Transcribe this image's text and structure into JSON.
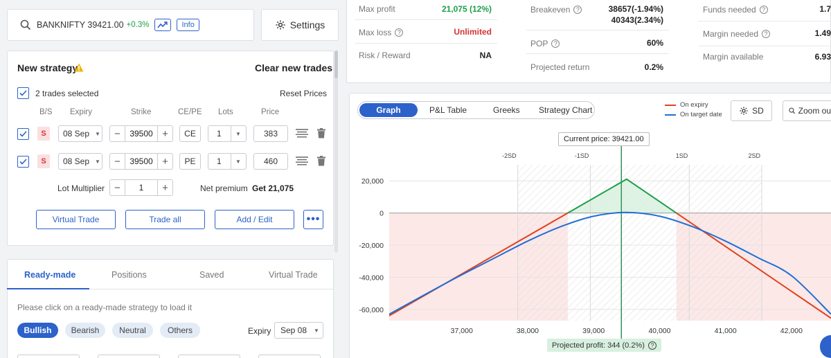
{
  "search": {
    "symbol_price": "BANKNIFTY 39421.00",
    "change": "+0.3%",
    "info_label": "Info"
  },
  "settings": {
    "label": "Settings"
  },
  "strategy": {
    "title": "New strategy",
    "clear_label": "Clear new trades",
    "trades_selected": "2 trades selected",
    "reset_label": "Reset Prices",
    "columns": [
      "B/S",
      "Expiry",
      "Strike",
      "CE/PE",
      "Lots",
      "Price"
    ],
    "trades": [
      {
        "side": "S",
        "expiry": "08 Sep",
        "strike": "39500",
        "type": "CE",
        "lots": "1",
        "price": "383"
      },
      {
        "side": "S",
        "expiry": "08 Sep",
        "strike": "39500",
        "type": "PE",
        "lots": "1",
        "price": "460"
      }
    ],
    "lot_multiplier_label": "Lot Multiplier",
    "lot_multiplier_value": "1",
    "net_premium_label": "Net premium",
    "net_premium_value": "Get 21,075",
    "buttons": {
      "virtual_trade": "Virtual Trade",
      "trade_all": "Trade all",
      "add_edit": "Add / Edit"
    }
  },
  "tabs_panel": {
    "tabs": [
      "Ready-made",
      "Positions",
      "Saved",
      "Virtual Trade"
    ],
    "hint": "Please click on a ready-made strategy to load it",
    "filters": [
      "Bullish",
      "Bearish",
      "Neutral",
      "Others"
    ],
    "expiry_label": "Expiry",
    "expiry_value": "Sep 08"
  },
  "stats": {
    "max_profit_label": "Max profit",
    "max_profit_value": "21,075 (12%)",
    "max_loss_label": "Max loss",
    "max_loss_value": "Unlimited",
    "risk_reward_label": "Risk / Reward",
    "risk_reward_value": "NA",
    "breakeven_label": "Breakeven",
    "breakeven_value_1": "38657(-1.94%)",
    "breakeven_value_2": "40343(2.34%)",
    "pop_label": "POP",
    "pop_value": "60%",
    "projected_return_label": "Projected return",
    "projected_return_value": "0.2%",
    "funds_needed_label": "Funds needed",
    "funds_needed_value": "1.7",
    "margin_needed_label": "Margin needed",
    "margin_needed_value": "1.49",
    "margin_available_label": "Margin available",
    "margin_available_value": "6.93"
  },
  "graph_tabs": {
    "items": [
      "Graph",
      "P&L Table",
      "Greeks",
      "Strategy Chart"
    ],
    "active": "Graph"
  },
  "legend": {
    "on_expiry": "On expiry",
    "on_target": "On target date"
  },
  "sd_button": "SD",
  "zoom_button": "Zoom ou",
  "colors": {
    "accent": "#2c62c9",
    "profit": "#1e9e4a",
    "loss": "#d33333",
    "expiry_line": "#e0431f",
    "target_line": "#1f6fd6"
  },
  "chart_data": {
    "type": "line",
    "x_ticks": [
      "37,000",
      "38,000",
      "39,000",
      "40,000",
      "41,000",
      "42,000"
    ],
    "y_ticks": [
      "20,000",
      "0",
      "-20,000",
      "-40,000",
      "-60,000"
    ],
    "xlim": [
      35900,
      42600
    ],
    "ylim": [
      -67000,
      30000
    ],
    "sd_labels": [
      "-2SD",
      "-1SD",
      "1SD",
      "2SD"
    ],
    "sd_values": [
      37850,
      38950,
      40450,
      41550
    ],
    "current_price": 39421,
    "current_price_label": "Current price: 39421.00",
    "projected_label": "Projected profit: 344 (0.2%)",
    "series": [
      {
        "name": "On expiry",
        "x": [
          35900,
          39500,
          42600
        ],
        "y": [
          -64000,
          21075,
          -65500
        ]
      },
      {
        "name": "On target date",
        "x": [
          35900,
          36500,
          37000,
          37500,
          38000,
          38500,
          39000,
          39500,
          40000,
          40500,
          41000,
          41500,
          42000,
          42600
        ],
        "y": [
          -63000,
          -49500,
          -38500,
          -28000,
          -17500,
          -8500,
          -2000,
          344,
          -2000,
          -8500,
          -17500,
          -28000,
          -39000,
          -63000
        ]
      }
    ]
  }
}
